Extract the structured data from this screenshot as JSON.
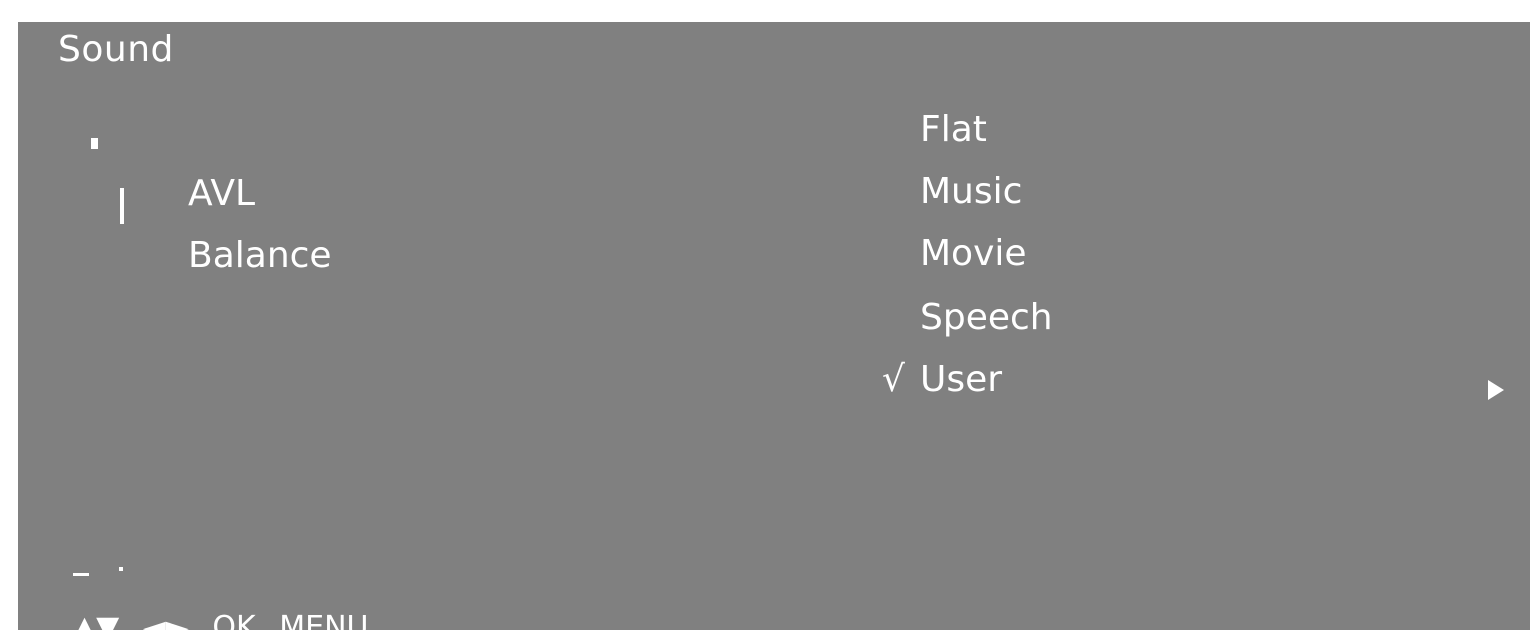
{
  "osd": {
    "title": "Sound",
    "left_menu": {
      "items": [
        {
          "label": "AVL",
          "selected": true
        },
        {
          "label": "Balance",
          "selected": false
        }
      ]
    },
    "submenu": {
      "items": [
        {
          "label": "Flat",
          "checked": false
        },
        {
          "label": "Music",
          "checked": false
        },
        {
          "label": "Movie",
          "checked": false
        },
        {
          "label": "Speech",
          "checked": false
        },
        {
          "label": "User",
          "checked": true
        }
      ],
      "check_glyph": "√"
    },
    "footer": {
      "nav_keys": [
        "▲▼",
        "◄►",
        "OK",
        "MENU"
      ]
    },
    "colors": {
      "panel": "#808080",
      "text": "#ffffff",
      "background": "#ffffff"
    }
  }
}
